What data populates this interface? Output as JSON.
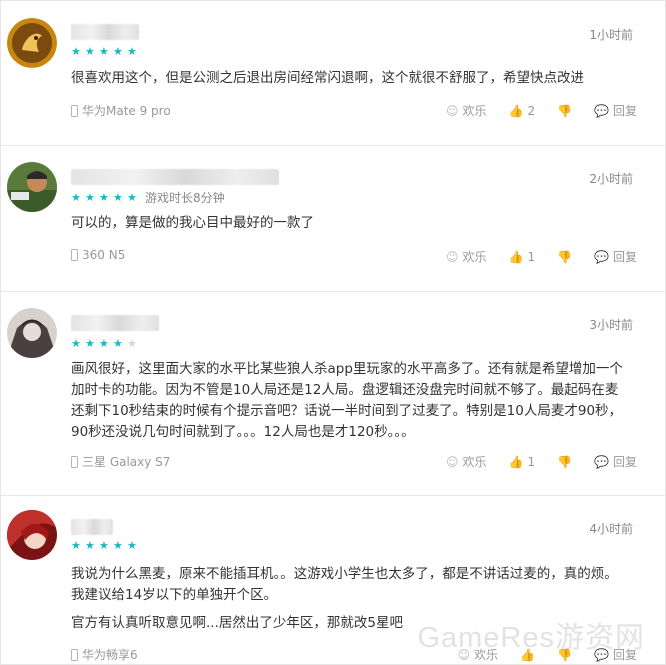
{
  "reviews": [
    {
      "time": "1小时前",
      "rating": 5,
      "extra": "",
      "text": "很喜欢用这个，但是公测之后退出房间经常闪退啊，这个就很不舒服了，希望快点改进",
      "device": "华为Mate 9 pro",
      "likes": "2",
      "fun_label": "欢乐",
      "reply_label": "回复"
    },
    {
      "time": "2小时前",
      "rating": 5,
      "extra": "游戏时长8分钟",
      "text": "可以的，算是做的我心目中最好的一款了",
      "device": "360 N5",
      "likes": "1",
      "fun_label": "欢乐",
      "reply_label": "回复"
    },
    {
      "time": "3小时前",
      "rating": 4,
      "extra": "",
      "text": "画风很好，这里面大家的水平比某些狼人杀app里玩家的水平高多了。还有就是希望增加一个加时卡的功能。因为不管是10人局还是12人局。盘逻辑还没盘完时间就不够了。最起码在麦还剩下10秒结束的时候有个提示音吧？话说一半时间到了过麦了。特别是10人局麦才90秒，90秒还没说几句时间就到了。。。12人局也是才120秒。。。",
      "device": "三星 Galaxy S7",
      "likes": "1",
      "fun_label": "欢乐",
      "reply_label": "回复"
    },
    {
      "time": "4小时前",
      "rating": 5,
      "extra": "",
      "text": "我说为什么黑麦，原来不能插耳机。。这游戏小学生也太多了，都是不讲话过麦的，真的烦。我建议给14岁以下的单独开个区。",
      "text2": "官方有认真听取意见啊...居然出了少年区，那就改5星吧",
      "device": "华为畅享6",
      "likes": "",
      "fun_label": "欢乐",
      "reply_label": "回复"
    }
  ],
  "watermark": "GameRes游资网",
  "colors": {
    "star": "#19b7c6",
    "muted": "#999999"
  }
}
